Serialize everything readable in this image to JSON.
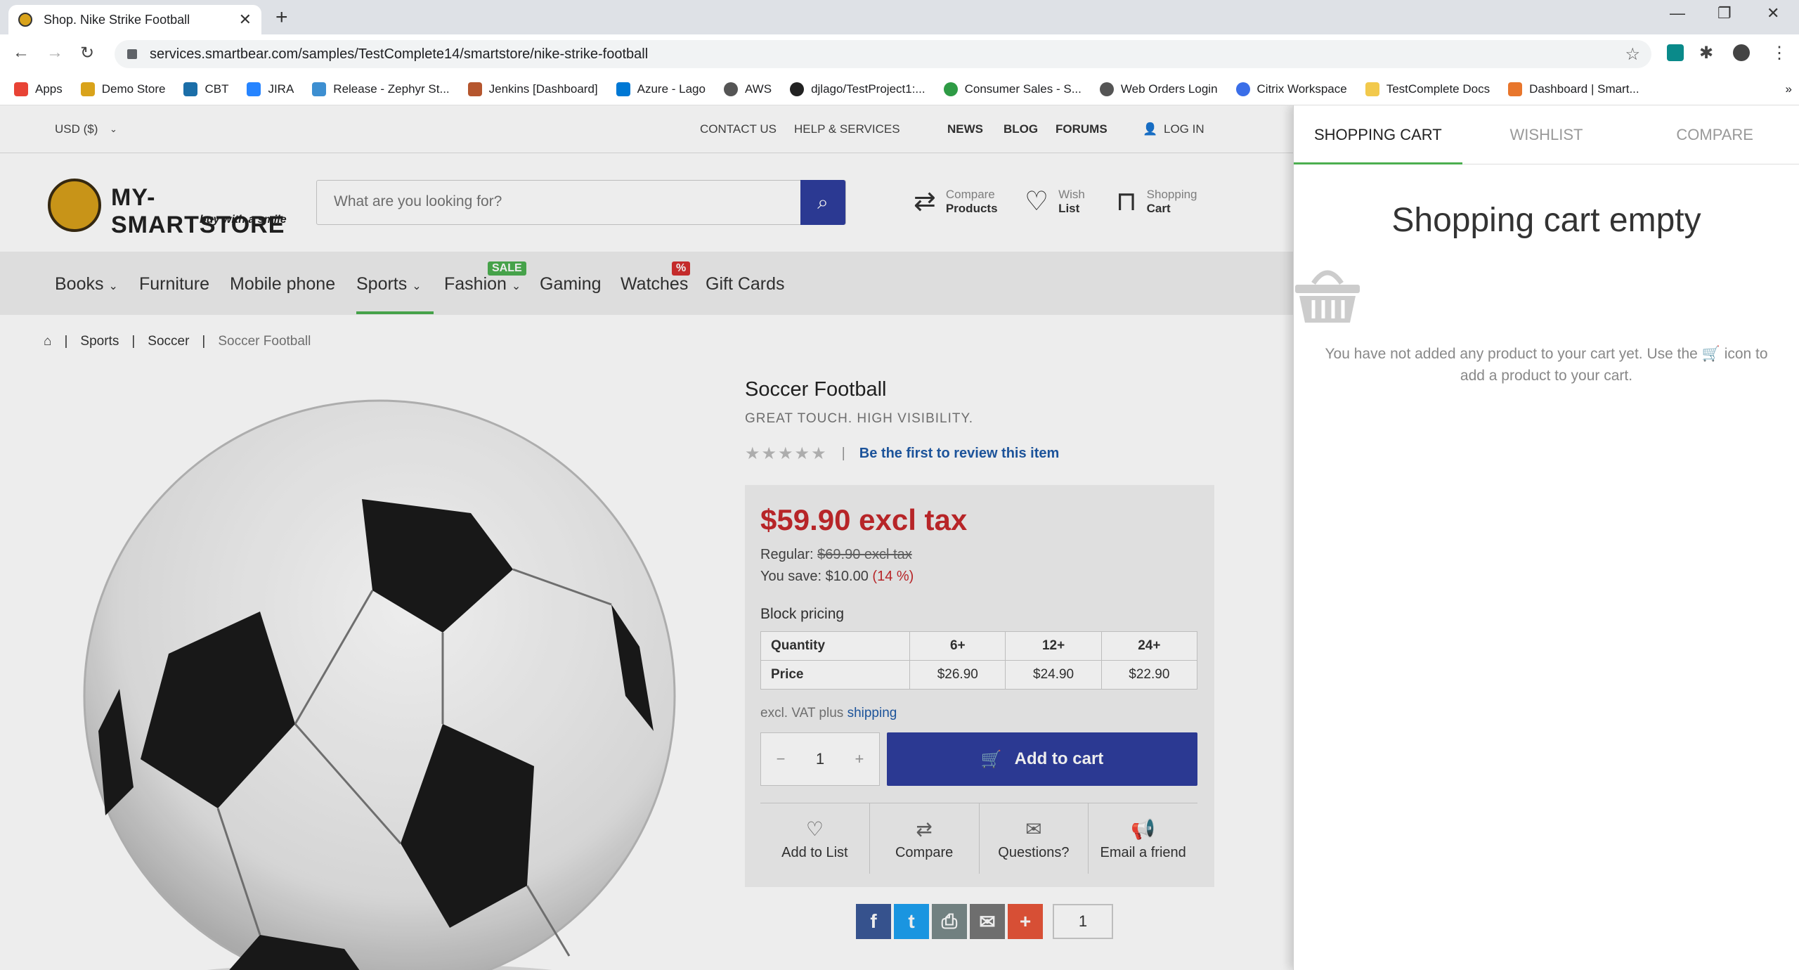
{
  "browser": {
    "tab_title": "Shop. Nike Strike Football",
    "url": "services.smartbear.com/samples/TestComplete14/smartstore/nike-strike-football",
    "bookmarks": [
      {
        "label": "Apps",
        "color": "#e84335"
      },
      {
        "label": "Demo Store",
        "color": "#d9a31b"
      },
      {
        "label": "CBT",
        "color": "#1b6ea8"
      },
      {
        "label": "JIRA",
        "color": "#2684ff"
      },
      {
        "label": "Release - Zephyr St...",
        "color": "#3d8fd1"
      },
      {
        "label": "Jenkins [Dashboard]",
        "color": "#b5562e"
      },
      {
        "label": "Azure - Lago",
        "color": "#0078d4"
      },
      {
        "label": "AWS",
        "color": "#555555"
      },
      {
        "label": "djlago/TestProject1:...",
        "color": "#222222"
      },
      {
        "label": "Consumer Sales - S...",
        "color": "#2e9b45"
      },
      {
        "label": "Web Orders Login",
        "color": "#555555"
      },
      {
        "label": "Citrix Workspace",
        "color": "#3a6ee8"
      },
      {
        "label": "TestComplete Docs",
        "color": "#f2c94c"
      },
      {
        "label": "Dashboard | Smart...",
        "color": "#e8762c"
      }
    ]
  },
  "topbar": {
    "currency": "USD  ($)",
    "contact": "CONTACT US",
    "help": "HELP & SERVICES",
    "news": "NEWS",
    "blog": "BLOG",
    "forums": "FORUMS",
    "login": "LOG IN"
  },
  "header": {
    "logo_name": "MY-SMARTSTORE",
    "logo_sub": "buy with a smile",
    "search_placeholder": "What are you looking for?",
    "compare_top": "Compare",
    "compare_bottom": "Products",
    "wish_top": "Wish",
    "wish_bottom": "List",
    "cart_top": "Shopping",
    "cart_bottom": "Cart"
  },
  "nav": {
    "books": "Books",
    "furniture": "Furniture",
    "mobile": "Mobile phone",
    "sports": "Sports",
    "fashion": "Fashion",
    "gaming": "Gaming",
    "watches": "Watches",
    "giftcards": "Gift Cards",
    "sale_badge": "SALE",
    "pct_badge": "%"
  },
  "breadcrumb": {
    "sep": "|",
    "sports": "Sports",
    "soccer": "Soccer",
    "current": "Soccer Football"
  },
  "product": {
    "title": "Soccer Football",
    "subtitle": "GREAT TOUCH. HIGH VISIBILITY.",
    "rating_stars": "★★★★★",
    "review_link": "Be the first to review this item",
    "price": "$59.90 excl tax",
    "regular_label": "Regular:",
    "regular_price": "$69.90 excl tax",
    "save_label": "You save: $10.00",
    "save_pct": "(14 %)",
    "block_pricing": "Block pricing",
    "bp_header": [
      "Quantity",
      "6+",
      "12+",
      "24+"
    ],
    "bp_price": [
      "Price",
      "$26.90",
      "$24.90",
      "$22.90"
    ],
    "excl_vat": "excl. VAT plus",
    "shipping": "shipping",
    "qty": "1",
    "add_to_cart": "Add to cart",
    "actions": [
      "Add to List",
      "Compare",
      "Questions?",
      "Email a friend"
    ],
    "share_count": "1"
  },
  "panel": {
    "tabs": [
      "SHOPPING CART",
      "WISHLIST",
      "COMPARE"
    ],
    "empty_title": "Shopping cart empty",
    "empty_msg_1": "You have not added any product to your cart yet. Use the",
    "empty_msg_2": "icon to add a product to your cart."
  }
}
